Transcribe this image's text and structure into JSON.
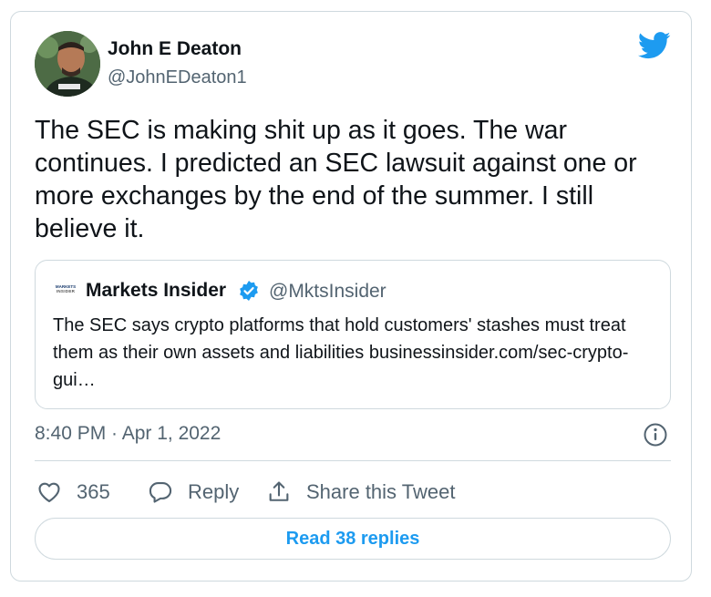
{
  "author": {
    "name": "John E Deaton",
    "handle": "@JohnEDeaton1"
  },
  "tweet": {
    "text": "The SEC is making shit up as it goes. The war continues. I predicted an SEC lawsuit against one or more exchanges by the end of the summer. I still believe it.",
    "timestamp": "8:40 PM · Apr 1, 2022"
  },
  "quote": {
    "logo_line1": "MARKETS",
    "logo_line2": "INSIDER",
    "name": "Markets Insider",
    "handle": "@MktsInsider",
    "text": "The SEC says crypto platforms that hold customers' stashes must treat them as their own assets and liabilities businessinsider.com/sec-crypto-gui…"
  },
  "actions": {
    "like_count": "365",
    "reply_label": "Reply",
    "share_label": "Share this Tweet"
  },
  "read_replies_label": "Read 38 replies",
  "icons": {
    "brand": "twitter-bird-icon",
    "verified": "verified-badge-icon",
    "info": "info-icon",
    "like": "heart-icon",
    "reply": "reply-icon",
    "share": "share-icon"
  },
  "colors": {
    "twitter_blue": "#1d9bf0",
    "text_primary": "#0f1419",
    "text_secondary": "#536471",
    "border": "#cfd9de"
  }
}
